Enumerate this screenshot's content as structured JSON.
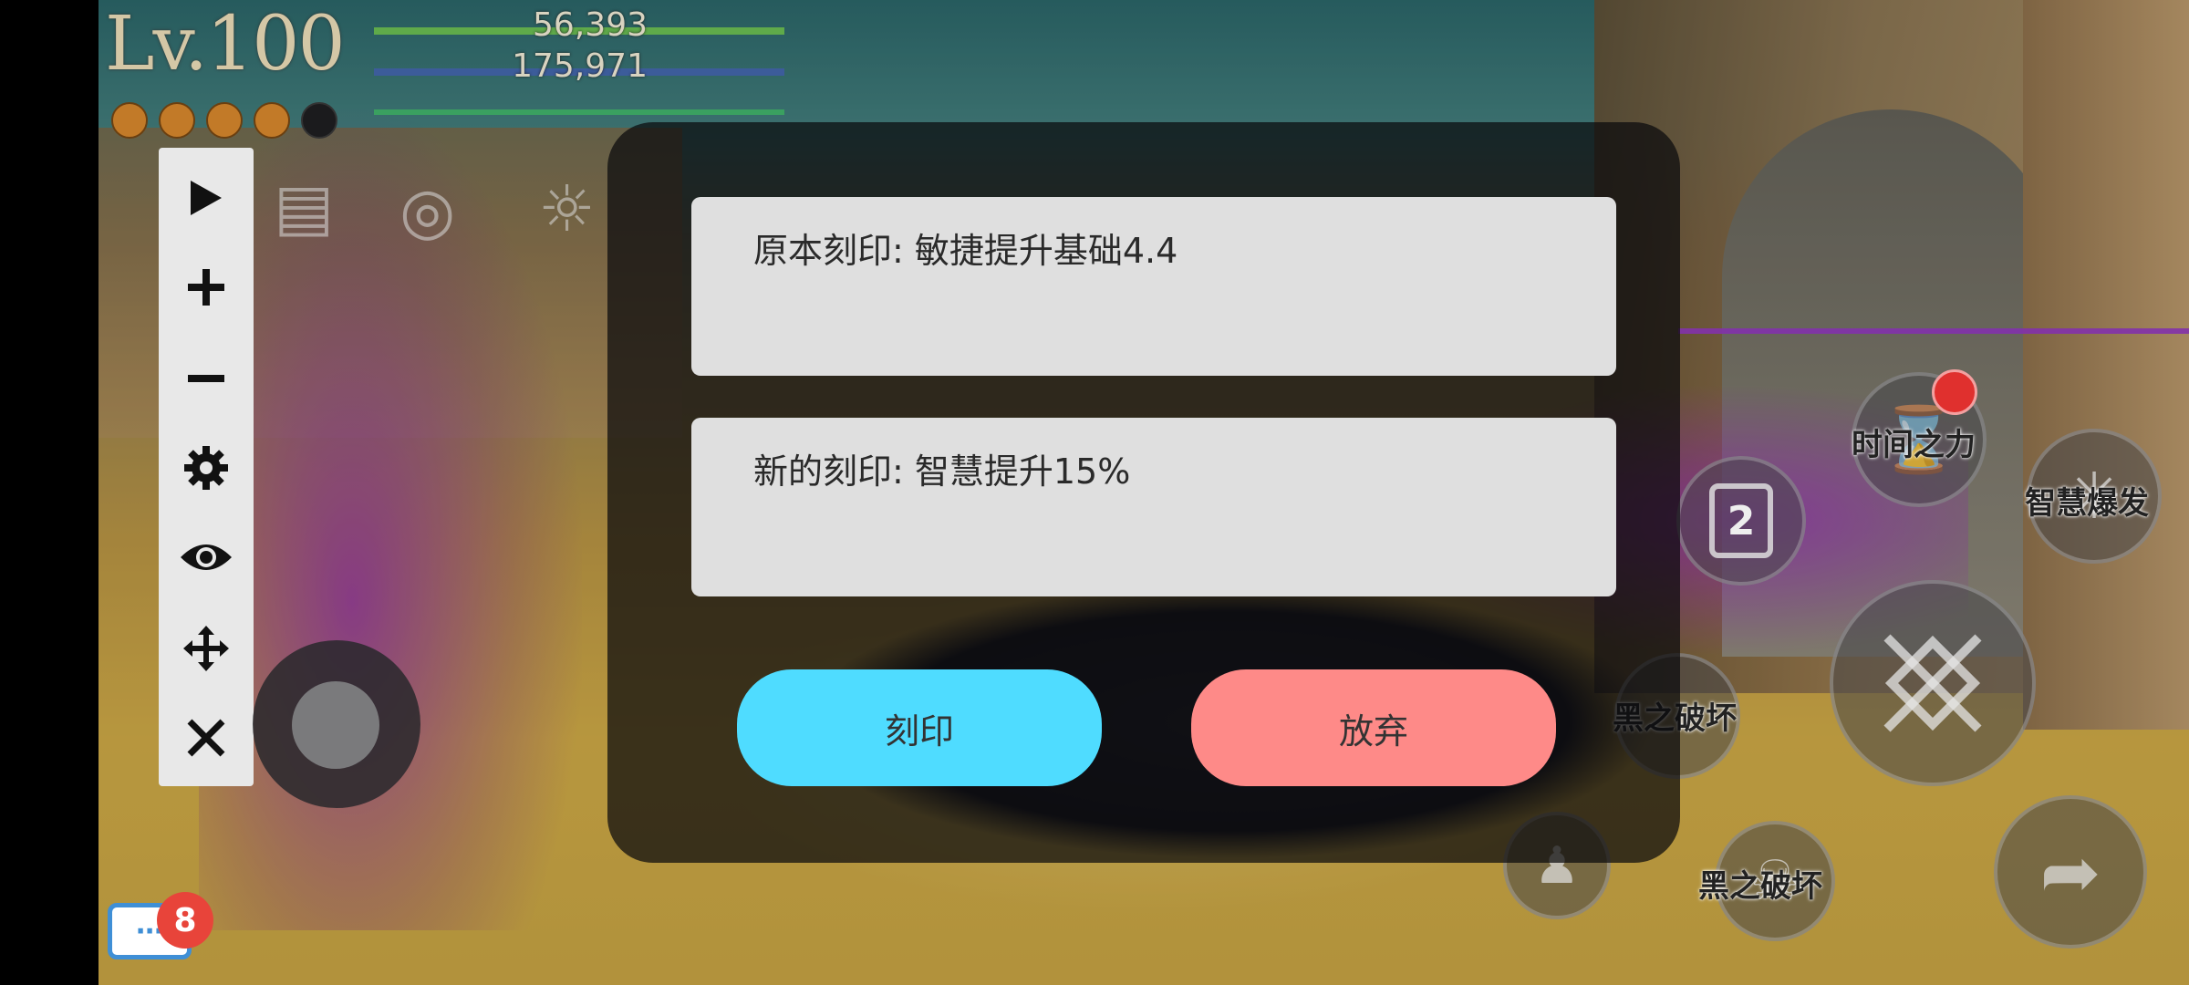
{
  "hud": {
    "level": "Lv.100",
    "hp_value": "56,393",
    "mp_value": "175,971",
    "orbs_filled": 4,
    "orbs_total": 5
  },
  "toolbar": {
    "items": [
      "play-icon",
      "plus-icon",
      "minus-icon",
      "gear-icon",
      "eye-icon",
      "move-icon",
      "close-icon"
    ]
  },
  "dialog": {
    "original_label": "原本刻印: 敏捷提升基础4.4",
    "new_label": "新的刻印: 智慧提升15%",
    "stamp_button": "刻印",
    "abandon_button": "放弃",
    "stamp_color": "#4fdcff",
    "abandon_color": "#fe8a88"
  },
  "skills": {
    "time_power": "时间之力",
    "wisdom_burst": "智慧爆发",
    "dark_destroy_1": "黑之破坏",
    "dark_destroy_2": "黑之破坏",
    "slot_number": "2"
  },
  "chat": {
    "badge_count": "8"
  }
}
